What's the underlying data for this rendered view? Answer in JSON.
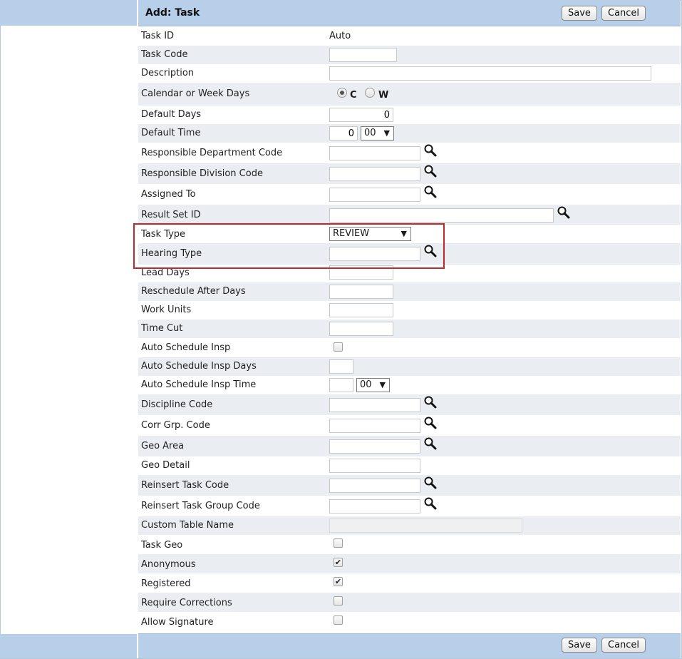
{
  "header": {
    "title": "Add: Task",
    "save_label": "Save",
    "cancel_label": "Cancel"
  },
  "footer": {
    "save_label": "Save",
    "cancel_label": "Cancel"
  },
  "fields": {
    "task_id": {
      "label": "Task ID",
      "value": "Auto"
    },
    "task_code": {
      "label": "Task Code",
      "value": ""
    },
    "description": {
      "label": "Description",
      "value": ""
    },
    "calendar_or_week_days": {
      "label": "Calendar or Week Days",
      "option_c": "C",
      "option_w": "W",
      "selected": "C"
    },
    "default_days": {
      "label": "Default Days",
      "value": "0"
    },
    "default_time": {
      "label": "Default Time",
      "hour_value": "0",
      "minute_value": "00"
    },
    "responsible_department_code": {
      "label": "Responsible Department Code",
      "value": ""
    },
    "responsible_division_code": {
      "label": "Responsible Division Code",
      "value": ""
    },
    "assigned_to": {
      "label": "Assigned To",
      "value": ""
    },
    "result_set_id": {
      "label": "Result Set ID",
      "value": ""
    },
    "task_type": {
      "label": "Task Type",
      "value": "REVIEW"
    },
    "hearing_type": {
      "label": "Hearing Type",
      "value": ""
    },
    "lead_days": {
      "label": "Lead Days",
      "value": ""
    },
    "reschedule_after_days": {
      "label": "Reschedule After Days",
      "value": ""
    },
    "work_units": {
      "label": "Work Units",
      "value": ""
    },
    "time_cut": {
      "label": "Time Cut",
      "value": ""
    },
    "auto_schedule_insp": {
      "label": "Auto Schedule Insp",
      "checked": false
    },
    "auto_schedule_insp_days": {
      "label": "Auto Schedule Insp Days",
      "value": ""
    },
    "auto_schedule_insp_time": {
      "label": "Auto Schedule Insp Time",
      "hour_value": "",
      "minute_value": "00"
    },
    "discipline_code": {
      "label": "Discipline Code",
      "value": ""
    },
    "corr_grp_code": {
      "label": "Corr Grp. Code",
      "value": ""
    },
    "geo_area": {
      "label": "Geo Area",
      "value": ""
    },
    "geo_detail": {
      "label": "Geo Detail",
      "value": ""
    },
    "reinsert_task_code": {
      "label": "Reinsert Task Code",
      "value": ""
    },
    "reinsert_task_group_code": {
      "label": "Reinsert Task Group Code",
      "value": ""
    },
    "custom_table_name": {
      "label": "Custom Table Name",
      "value": ""
    },
    "task_geo": {
      "label": "Task Geo",
      "checked": false
    },
    "anonymous": {
      "label": "Anonymous",
      "checked": true
    },
    "registered": {
      "label": "Registered",
      "checked": true
    },
    "require_corrections": {
      "label": "Require Corrections",
      "checked": false
    },
    "allow_signature": {
      "label": "Allow Signature",
      "checked": false
    }
  },
  "icons": {
    "lookup": "magnifier-icon",
    "dropdown": "triangle-down-icon",
    "check": "checkmark-icon"
  },
  "colors": {
    "header_bg": "#b8cfe9",
    "row_alt_bg": "#eaeef3",
    "highlight_border": "#c0282b"
  }
}
